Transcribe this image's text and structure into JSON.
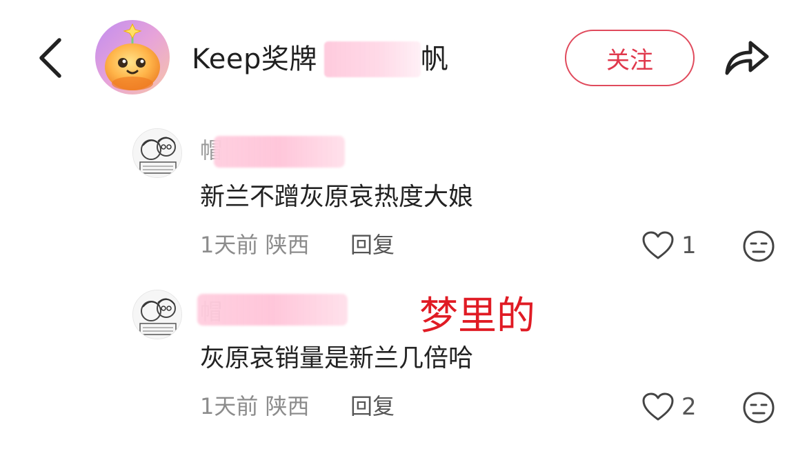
{
  "header": {
    "account_name": "Keep奖牌",
    "account_name_masked_tail": "帆",
    "follow_label": "关注",
    "back_icon": "chevron-left-icon",
    "share_icon": "share-arrow-icon"
  },
  "comments": [
    {
      "username": "帽",
      "text": "新兰不蹭灰原哀热度大娘",
      "time": "1天前",
      "location": "陕西",
      "reply_label": "回复",
      "likes": "1"
    },
    {
      "username": "帽",
      "text": "灰原哀销量是新兰几倍哈",
      "time": "1天前",
      "location": "陕西",
      "reply_label": "回复",
      "likes": "2"
    }
  ],
  "annotation": {
    "text": "梦里的"
  },
  "colors": {
    "accent": "#e0384c",
    "annotation": "#e01b24",
    "mask": "#ffc8dc"
  }
}
